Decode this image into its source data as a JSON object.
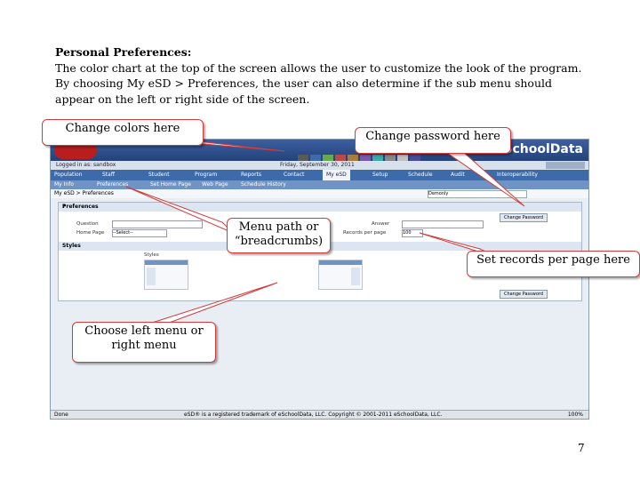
{
  "intro": {
    "heading": "Personal Preferences:",
    "body": "The color chart at the top of the screen allows the user to customize the look of the program.  By choosing My eSD > Preferences, the user can also determine if the sub menu should appear on the left or right side of the screen."
  },
  "screenshot": {
    "brand": "SchoolData",
    "logged_in": "Logged in as: sandbox",
    "date": "Friday, September 30, 2011",
    "menu": [
      "Population",
      "Staff",
      "Student",
      "Program",
      "Reports",
      "Contact",
      "My eSD",
      "Setup",
      "Schedule",
      "Audit",
      "Interoperability"
    ],
    "active_menu": "My eSD",
    "submenu": [
      "My Info",
      "Preferences",
      "Set Home Page",
      "Web Page",
      "Schedule History"
    ],
    "breadcrumb": "My eSD > Preferences",
    "district_select": "Demonly",
    "panel_title": "Preferences",
    "change_password_button": "Change Password",
    "answer_label": "Answer",
    "records_label": "Records per page",
    "records_value": "100",
    "select_placeholder": "--Select--",
    "home_page_label": "Home Page",
    "question_label": "Question",
    "styles_header": "Styles",
    "styles_option": "Styles",
    "status_left": "Done",
    "status_center": "eSD® is a registered trademark of eSchoolData, LLC.  Copyright © 2001-2011 eSchoolData, LLC.",
    "status_right": "100%"
  },
  "swatch_colors": [
    "#5a5a5a",
    "#3d6aa8",
    "#6aa84f",
    "#b84a4a",
    "#a87c3d",
    "#7a5aa8",
    "#3da8a8",
    "#888888",
    "#c0c0c0",
    "#4a4a9a"
  ],
  "callouts": {
    "change_colors": "Change colors here",
    "change_password": "Change password here",
    "menu_path": "Menu path or “breadcrumbs)",
    "records_per_page": "Set records per page here",
    "left_right_menu": "Choose left menu or right menu"
  },
  "page_number": "7"
}
